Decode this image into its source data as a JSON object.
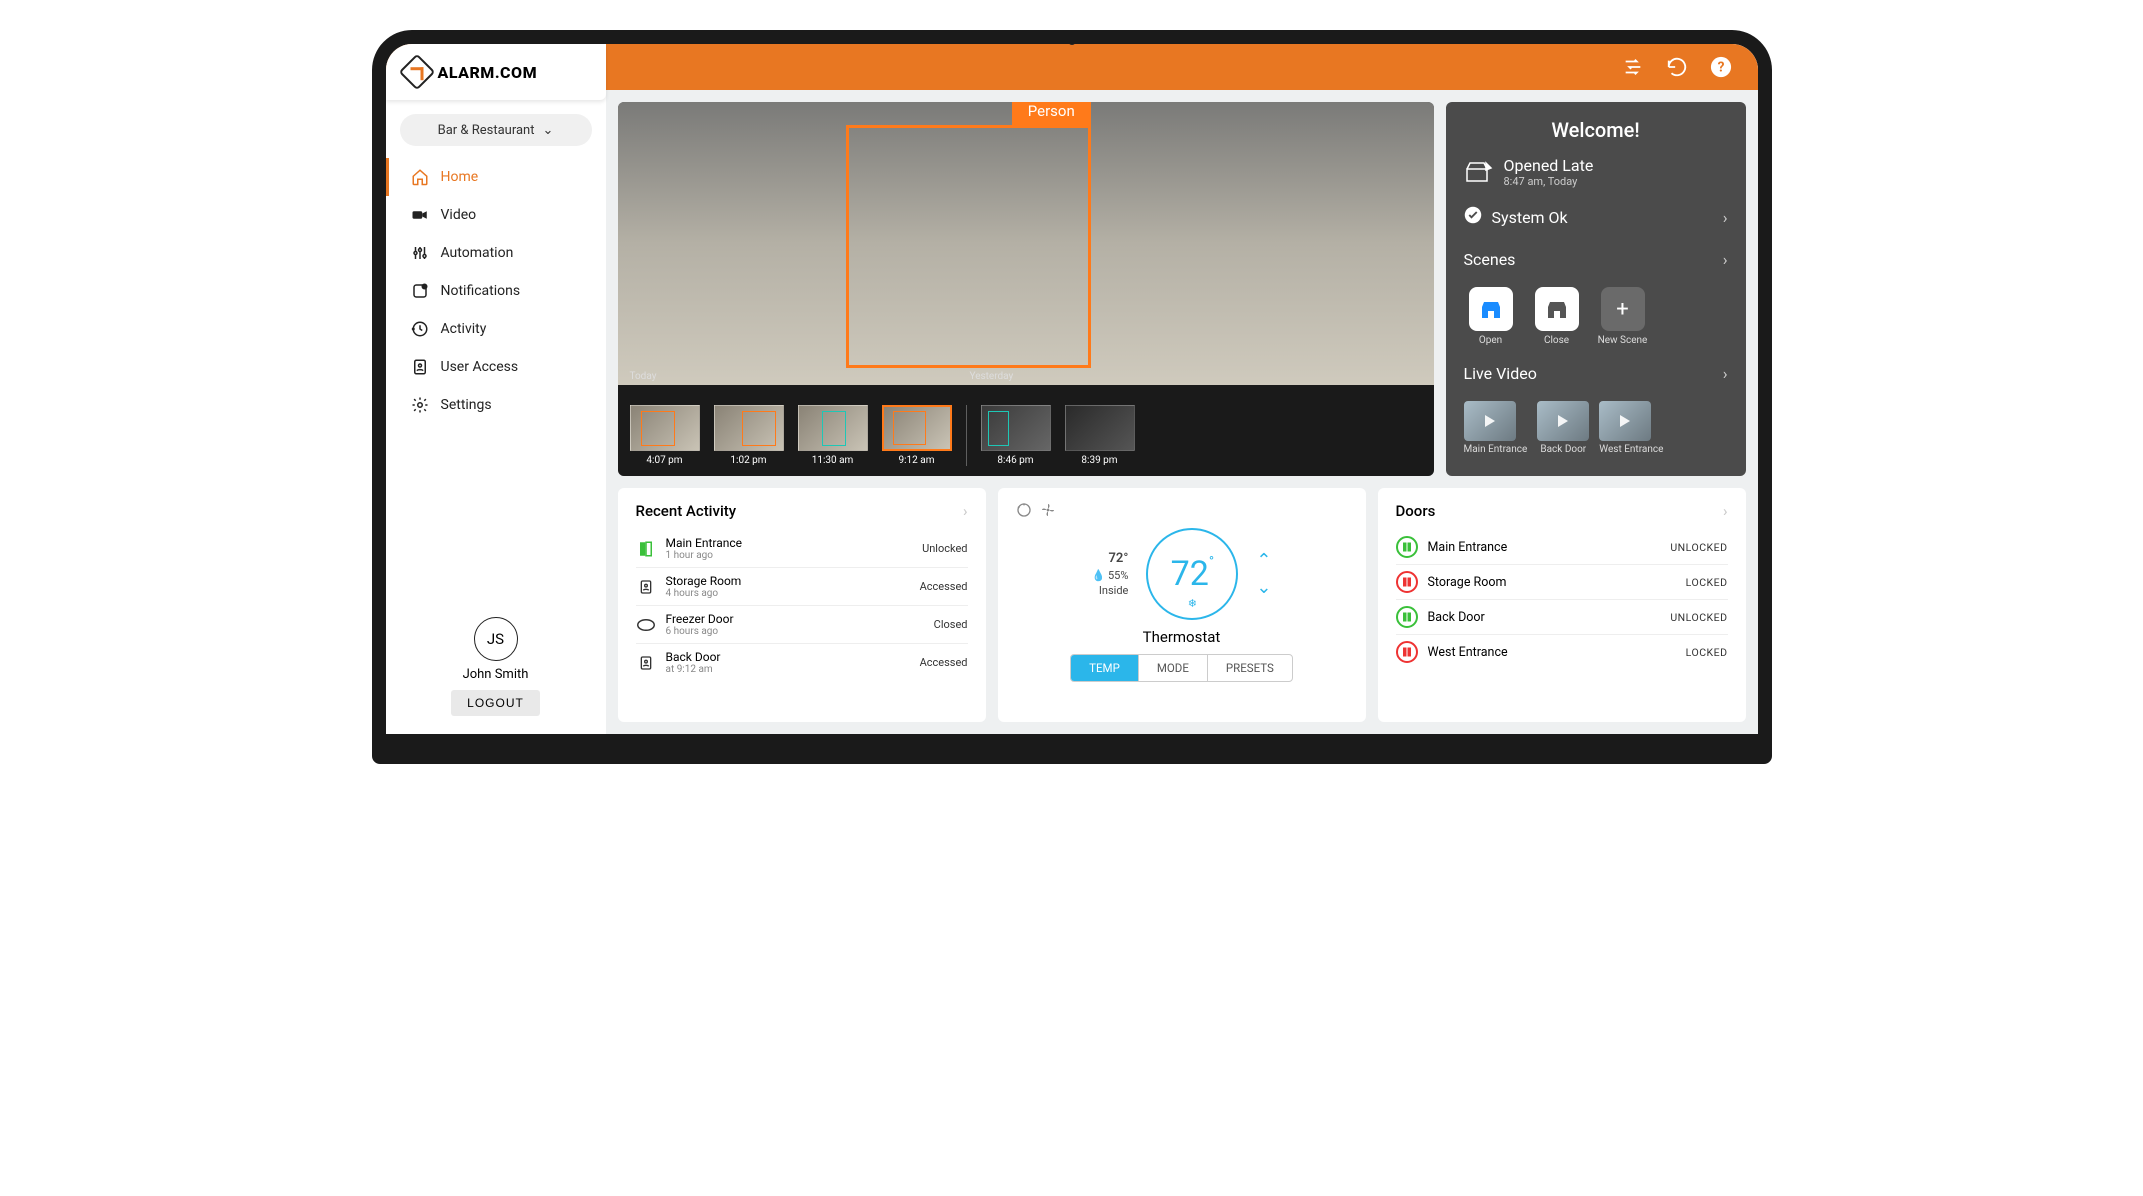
{
  "brand": "ALARM.COM",
  "location": "Bar & Restaurant",
  "nav": [
    "Home",
    "Video",
    "Automation",
    "Notifications",
    "Activity",
    "User Access",
    "Settings"
  ],
  "user": {
    "initials": "JS",
    "name": "John Smith",
    "logout": "LOGOUT"
  },
  "video": {
    "detection_label": "Person",
    "group_a": "Today",
    "group_b": "Yesterday",
    "thumbs_a": [
      "4:07 pm",
      "1:02 pm",
      "11:30 am",
      "9:12 am"
    ],
    "thumbs_b": [
      "8:46 pm",
      "8:39 pm"
    ]
  },
  "welcome": {
    "title": "Welcome!",
    "opened_title": "Opened Late",
    "opened_time": "8:47 am, Today",
    "system": "System Ok",
    "scenes_label": "Scenes",
    "scenes": [
      "Open",
      "Close",
      "New Scene"
    ],
    "live_label": "Live Video",
    "live": [
      "Main Entrance",
      "Back Door",
      "West Entrance"
    ]
  },
  "activity": {
    "title": "Recent Activity",
    "items": [
      {
        "name": "Main Entrance",
        "time": "1 hour ago",
        "status": "Unlocked",
        "icon": "door-open",
        "color": "#3ac03a"
      },
      {
        "name": "Storage Room",
        "time": "4 hours ago",
        "status": "Accessed",
        "icon": "badge",
        "color": "#333"
      },
      {
        "name": "Freezer Door",
        "time": "6 hours ago",
        "status": "Closed",
        "icon": "sensor",
        "color": "#333"
      },
      {
        "name": "Back Door",
        "time": "at 9:12 am",
        "status": "Accessed",
        "icon": "badge",
        "color": "#333"
      }
    ]
  },
  "thermo": {
    "outside": "72°",
    "humidity": "55%",
    "location": "Inside",
    "setpoint": "72",
    "label": "Thermostat",
    "seg": [
      "TEMP",
      "MODE",
      "PRESETS"
    ]
  },
  "doors": {
    "title": "Doors",
    "items": [
      {
        "name": "Main Entrance",
        "status": "UNLOCKED",
        "locked": false
      },
      {
        "name": "Storage Room",
        "status": "LOCKED",
        "locked": true
      },
      {
        "name": "Back Door",
        "status": "UNLOCKED",
        "locked": false
      },
      {
        "name": "West Entrance",
        "status": "LOCKED",
        "locked": true
      }
    ]
  }
}
